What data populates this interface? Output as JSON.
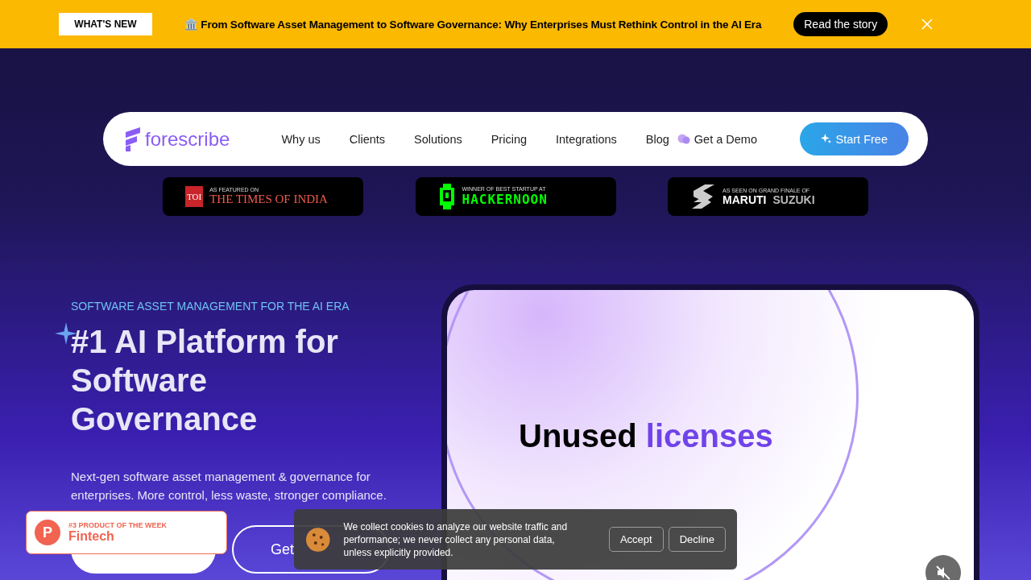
{
  "announcement": {
    "badge": "WHAT'S NEW",
    "emoji": "🏛️",
    "text": "From Software Asset Management to Software Governance: Why Enterprises Must Rethink Control in the AI Era",
    "button": "Read the story"
  },
  "nav": {
    "logo": "forescribe",
    "links": [
      "Why us",
      "Clients",
      "Solutions",
      "Pricing",
      "Integrations",
      "Blog"
    ],
    "demo": "Get a Demo",
    "cta": "Start Free"
  },
  "press": [
    {
      "kind": "toi",
      "caption": "AS FEATURED ON",
      "name": "THE TIMES OF INDIA",
      "mark": "TOI"
    },
    {
      "kind": "hackernoon",
      "caption": "WINNER OF BEST STARTUP AT",
      "name": "HACKERNOON"
    },
    {
      "kind": "maruti",
      "caption": "AS SEEN ON GRAND FINALE OF",
      "name": "MARUTI",
      "name2": "SUZUKI"
    }
  ],
  "hero": {
    "eyebrow": "SOFTWARE ASSET MANAGEMENT FOR THE AI ERA",
    "title": [
      "#1 AI Platform for",
      "Software",
      "Governance"
    ],
    "subtitle": "Next-gen software asset management & governance for enterprises. More control, less waste, stronger compliance.",
    "buttons": [
      "Get"
    ]
  },
  "showcase": {
    "word1": "Unused",
    "word2": "licenses"
  },
  "product_badge": {
    "mark": "P",
    "rank": "#3 PRODUCT OF THE WEEK",
    "category": "Fintech"
  },
  "cookie": {
    "text": "We collect cookies to analyze our website traffic and performance; we never collect any personal data, unless explicitly provided.",
    "accept": "Accept",
    "decline": "Decline"
  }
}
